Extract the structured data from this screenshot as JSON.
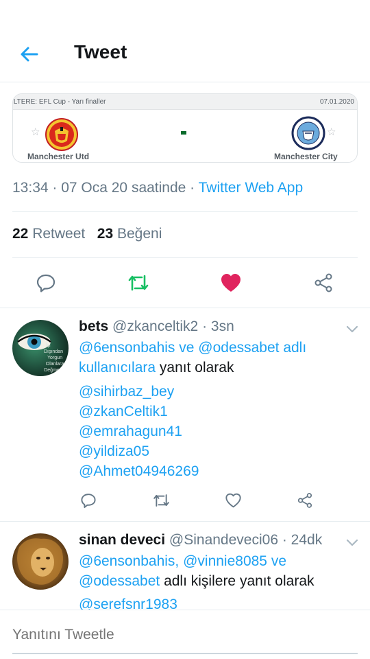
{
  "header": {
    "title": "Tweet"
  },
  "match_card": {
    "competition": "ILTERE: EFL Cup - Yarı finaller",
    "date": "07.01.2020",
    "home_team": "Manchester Utd",
    "away_team": "Manchester City",
    "score": "-"
  },
  "tweet": {
    "time_date": "13:34 · 07 Oca 20 saatinde · ",
    "source": "Twitter Web App",
    "retweets_count": "22",
    "retweets_label": "Retweet",
    "likes_count": "23",
    "likes_label": "Beğeni"
  },
  "actions": {
    "reply_icon": "reply-icon",
    "retweet_icon": "retweet-icon",
    "like_icon": "heart-icon",
    "share_icon": "share-icon",
    "retweet_color": "#17bf63",
    "like_color": "#e0245e"
  },
  "replies": [
    {
      "name": "bets",
      "handle": "@zkanceltik2 · 3sn",
      "avatar_text": [
        "İçi",
        "Dışından",
        "Yorgun",
        "Olanlara",
        "Değmeyin"
      ],
      "reply_to_line1": "@6ensonbahis ve @odessabet adlı",
      "reply_to_line2_link": "kullanıcılara",
      "reply_to_line2_rest": " yanıt olarak",
      "mentions": [
        "@sihirbaz_bey",
        "@zkanCeltik1",
        "@emrahagun41",
        "@yildiza05",
        "@Ahmet04946269"
      ]
    },
    {
      "name": "sinan deveci",
      "handle": "@Sinandeveci06 · 24dk",
      "reply_to_line1": "@6ensonbahis, @vinnie8085 ve",
      "reply_to_line2_link": "@odessabet",
      "reply_to_line2_rest": " adlı kişilere yanıt olarak",
      "mentions": [
        "@serefsnr1983"
      ]
    }
  ],
  "composer": {
    "placeholder": "Yanıtını Tweetle"
  }
}
